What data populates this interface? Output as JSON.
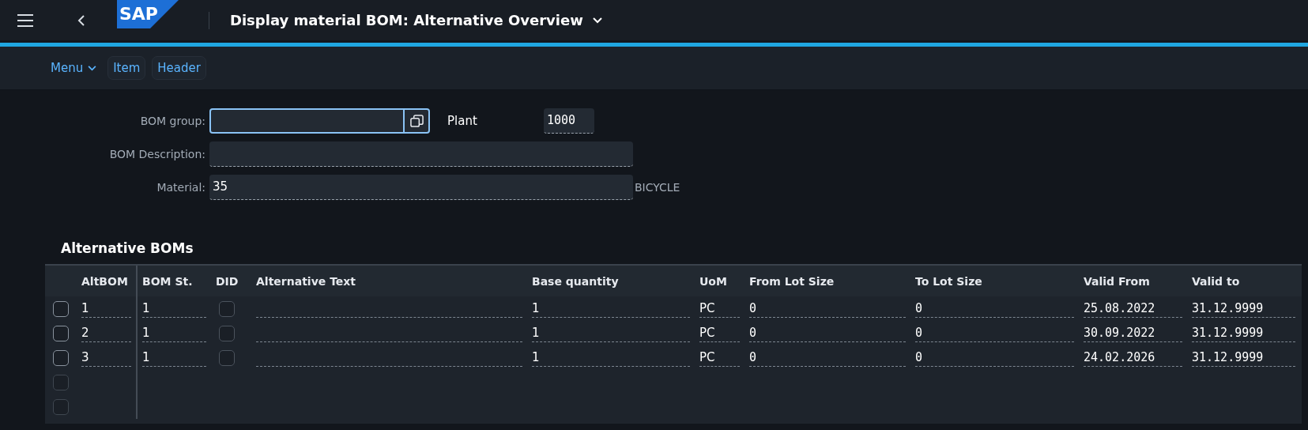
{
  "shell": {
    "logo": "SAP",
    "title": "Display material BOM: Alternative Overview"
  },
  "toolbar": {
    "menu": "Menu",
    "buttons": [
      "Item",
      "Header"
    ]
  },
  "form": {
    "bom_group": {
      "label": "BOM group:",
      "focused": true
    },
    "plant": {
      "label": "Plant",
      "value": "1000"
    },
    "bom_description": {
      "label": "BOM Description:"
    },
    "material": {
      "label": "Material:",
      "value": "35",
      "description": "BICYCLE"
    }
  },
  "table": {
    "title": "Alternative BOMs",
    "columns": [
      "AltBOM",
      "BOM St.",
      "DID",
      "Alternative Text",
      "Base quantity",
      "UoM",
      "From Lot Size",
      "To Lot Size",
      "Valid From",
      "Valid to"
    ],
    "rows": [
      {
        "selected": false,
        "alt_bom": "1",
        "bom_status": "1",
        "did": false,
        "base_quantity": "1",
        "uom": "PC",
        "from_lot_size": "0",
        "to_lot_size": "0",
        "valid_from": "25.08.2022",
        "valid_to": "31.12.9999"
      },
      {
        "selected": false,
        "alt_bom": "2",
        "bom_status": "1",
        "did": false,
        "base_quantity": "1",
        "uom": "PC",
        "from_lot_size": "0",
        "to_lot_size": "0",
        "valid_from": "30.09.2022",
        "valid_to": "31.12.9999"
      },
      {
        "selected": false,
        "alt_bom": "3",
        "bom_status": "1",
        "did": false,
        "base_quantity": "1",
        "uom": "PC",
        "from_lot_size": "0",
        "to_lot_size": "0",
        "valid_from": "24.02.2026",
        "valid_to": "31.12.9999"
      },
      {
        "selected": false
      },
      {
        "selected": false
      }
    ]
  }
}
